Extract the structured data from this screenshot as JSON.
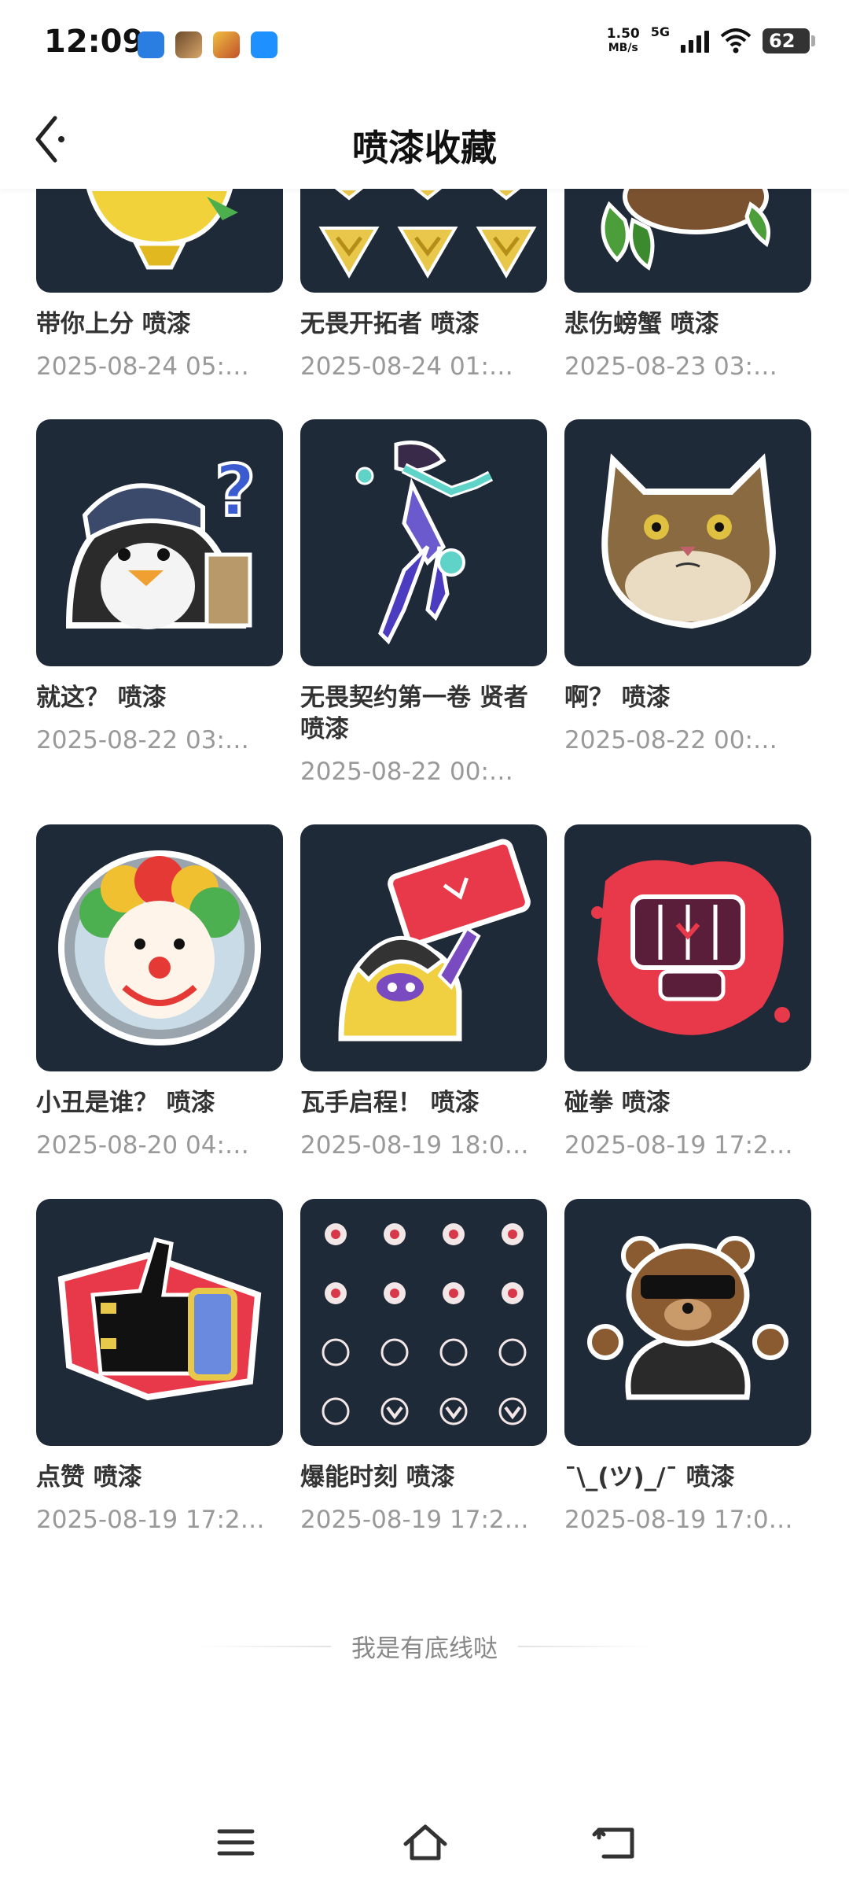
{
  "status_bar": {
    "time": "12:09",
    "net_speed_value": "1.50",
    "net_speed_unit": "MB/s",
    "network_type": "5G",
    "battery_level": "62",
    "notification_icons": [
      "du-app-icon",
      "game-app-icon-1",
      "game-app-icon-2",
      "blue-app-icon"
    ]
  },
  "header": {
    "title": "喷漆收藏",
    "back_icon": "chevron-left-icon"
  },
  "sprays": [
    {
      "name": "带你上分 喷漆",
      "date": "2025-08-24 05:…",
      "art": "yellow-creature"
    },
    {
      "name": "无畏开拓者 喷漆",
      "date": "2025-08-24 01:…",
      "art": "gold-badges"
    },
    {
      "name": "悲伤螃蟹 喷漆",
      "date": "2025-08-23 03:…",
      "art": "green-crab"
    },
    {
      "name": "就这？ 喷漆",
      "date": "2025-08-22 03:…",
      "art": "penguin-question"
    },
    {
      "name": "无畏契约第一卷 贤者 喷漆",
      "date": "2025-08-22 00:…",
      "art": "sage-agent"
    },
    {
      "name": "啊？ 喷漆",
      "date": "2025-08-22 00:…",
      "art": "confused-cat"
    },
    {
      "name": "小丑是谁？ 喷漆",
      "date": "2025-08-20 04:…",
      "art": "clown-mirror"
    },
    {
      "name": "瓦手启程！ 喷漆",
      "date": "2025-08-19 18:0…",
      "art": "creature-sign"
    },
    {
      "name": "碰拳 喷漆",
      "date": "2025-08-19 17:2…",
      "art": "fist-bump"
    },
    {
      "name": "点赞 喷漆",
      "date": "2025-08-19 17:2…",
      "art": "thumbs-up"
    },
    {
      "name": "爆能时刻 喷漆",
      "date": "2025-08-19 17:2…",
      "art": "icon-pattern"
    },
    {
      "name": "¯\\_(ツ)_/¯ 喷漆",
      "date": "2025-08-19 17:0…",
      "art": "shrug-bear"
    }
  ],
  "footer": {
    "end_text": "我是有底线哒"
  },
  "nav_bar": {
    "menu_icon": "menu-icon",
    "home_icon": "home-icon",
    "back_icon": "back-icon"
  },
  "colors": {
    "thumb_bg": "#1f2a38",
    "title_text": "#111111",
    "date_text": "#999999"
  }
}
